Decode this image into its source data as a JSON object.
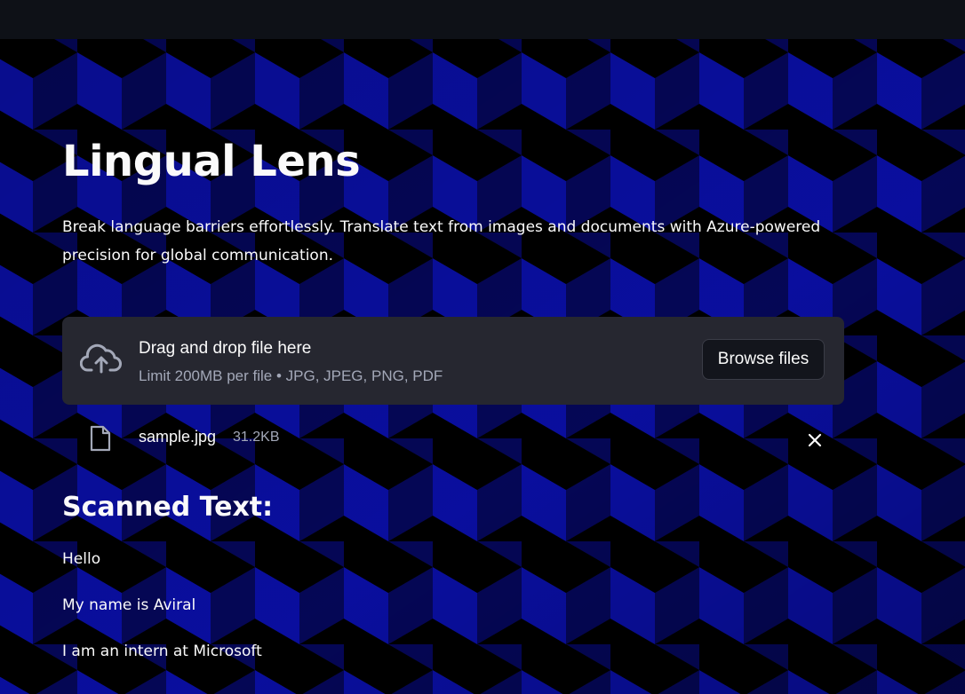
{
  "app": {
    "title": "Lingual Lens",
    "subtitle": "Break language barriers effortlessly. Translate text from images and documents with Azure-powered precision for global communication."
  },
  "uploader": {
    "drop_text": "Drag and drop file here",
    "limit_text": "Limit 200MB per file • JPG, JPEG, PNG, PDF",
    "browse_label": "Browse files",
    "icon": "cloud-upload-icon"
  },
  "uploaded_file": {
    "name": "sample.jpg",
    "size": "31.2KB",
    "icon": "file-icon",
    "remove_icon": "close-icon"
  },
  "results": {
    "heading": "Scanned Text:",
    "lines": [
      "Hello",
      "My name is Aviral",
      "I am an intern at Microsoft"
    ]
  },
  "colors": {
    "topbar": "#0e1117",
    "card": "#262730",
    "text": "#fafafa",
    "muted": "#a3a8b8",
    "pattern_bright": "#0a0fa6",
    "pattern_mid": "#05075a",
    "pattern_dark": "#000000"
  }
}
